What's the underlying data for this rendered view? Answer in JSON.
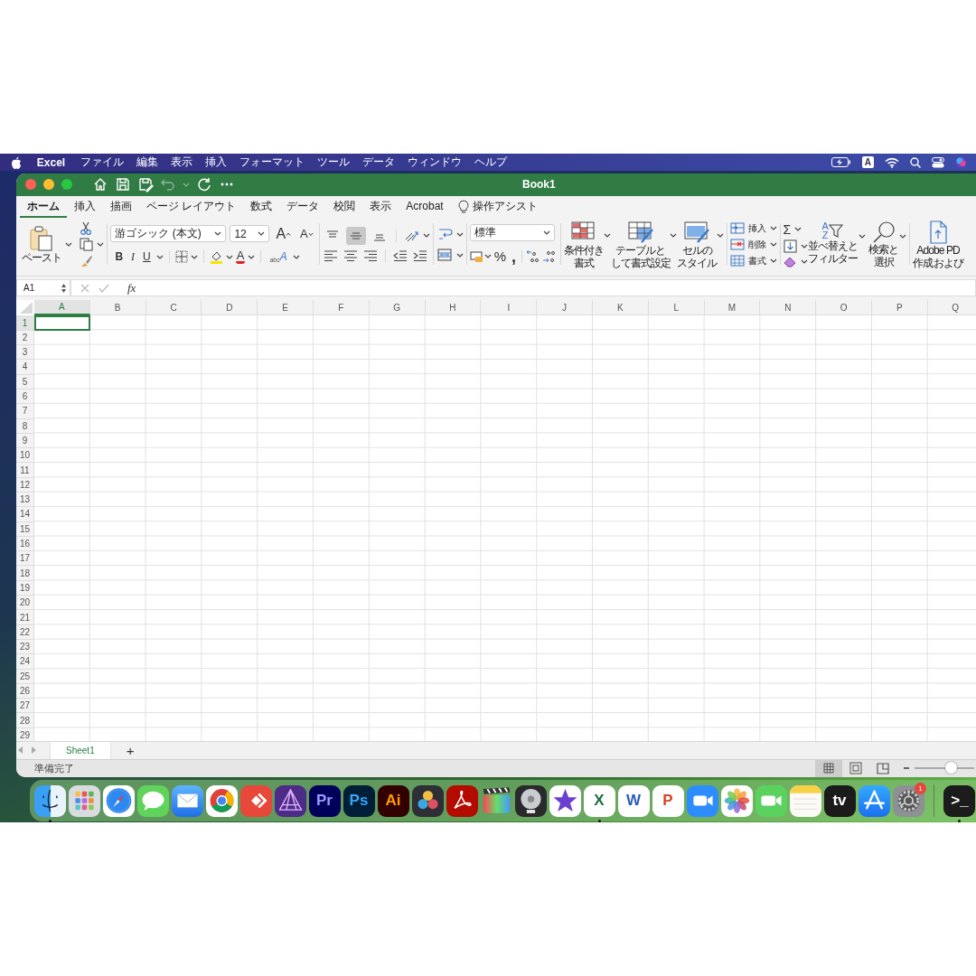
{
  "menu_bar": {
    "app": "Excel",
    "items": [
      "ファイル",
      "編集",
      "表示",
      "挿入",
      "フォーマット",
      "ツール",
      "データ",
      "ウィンドウ",
      "ヘルプ"
    ],
    "input_source": "A"
  },
  "window": {
    "title": "Book1",
    "quick_access": [
      {
        "kind": "home",
        "disabled": false
      },
      {
        "kind": "save",
        "disabled": false
      },
      {
        "kind": "save_as",
        "disabled": false
      },
      {
        "kind": "undo",
        "disabled": true
      },
      {
        "kind": "redo",
        "disabled": false
      },
      {
        "kind": "more",
        "disabled": false
      }
    ]
  },
  "tabs": [
    {
      "label": "ホーム",
      "selected": true
    },
    {
      "label": "挿入",
      "selected": false
    },
    {
      "label": "描画",
      "selected": false
    },
    {
      "label": "ページ レイアウト",
      "selected": false
    },
    {
      "label": "数式",
      "selected": false
    },
    {
      "label": "データ",
      "selected": false
    },
    {
      "label": "校閲",
      "selected": false
    },
    {
      "label": "表示",
      "selected": false
    },
    {
      "label": "Acrobat",
      "selected": false
    }
  ],
  "tell_me": "操作アシスト",
  "ribbon": {
    "paste": "ペースト",
    "font_name": "游ゴシック (本文)",
    "font_size": "12",
    "grow_font": "A",
    "shrink_font": "A",
    "font_styles": [
      {
        "kind": "bold",
        "label": "B"
      },
      {
        "kind": "italic",
        "label": "I"
      },
      {
        "kind": "underline",
        "label": "U"
      }
    ],
    "font_color": "A",
    "phonetic": {
      "small": "abc",
      "big": "A"
    },
    "vertical_align": [
      {
        "kind": "top",
        "selected": false
      },
      {
        "kind": "middle",
        "selected": true
      },
      {
        "kind": "bottom",
        "selected": false
      }
    ],
    "number_format": "標準",
    "percent": "%",
    "comma": ",",
    "styles": [
      {
        "kind": "conditional",
        "lines": [
          "条件付き",
          "書式"
        ]
      },
      {
        "kind": "table",
        "lines": [
          "テーブルと",
          "して書式設定"
        ]
      },
      {
        "kind": "cell",
        "lines": [
          "セルの",
          "スタイル"
        ]
      }
    ],
    "cells": [
      {
        "kind": "insert",
        "label": "挿入"
      },
      {
        "kind": "delete",
        "label": "削除"
      },
      {
        "kind": "format",
        "label": "書式"
      }
    ],
    "sum": "Σ",
    "sort_letters": [
      "A",
      "Z"
    ],
    "sort_filter": [
      "並べ替えと",
      "フィルター"
    ],
    "find_select": [
      "検索と",
      "選択"
    ],
    "adobe": [
      "Adobe PD",
      "作成および"
    ]
  },
  "formula_bar": {
    "name_box": "A1",
    "fx": "fx"
  },
  "grid": {
    "columns": [
      {
        "label": "A",
        "selected": true
      },
      {
        "label": "B",
        "selected": false
      },
      {
        "label": "C",
        "selected": false
      },
      {
        "label": "D",
        "selected": false
      },
      {
        "label": "E",
        "selected": false
      },
      {
        "label": "F",
        "selected": false
      },
      {
        "label": "G",
        "selected": false
      },
      {
        "label": "H",
        "selected": false
      },
      {
        "label": "I",
        "selected": false
      },
      {
        "label": "J",
        "selected": false
      },
      {
        "label": "K",
        "selected": false
      },
      {
        "label": "L",
        "selected": false
      },
      {
        "label": "M",
        "selected": false
      },
      {
        "label": "N",
        "selected": false
      },
      {
        "label": "O",
        "selected": false
      },
      {
        "label": "P",
        "selected": false
      },
      {
        "label": "Q",
        "selected": false
      }
    ],
    "rows": [
      {
        "label": "1",
        "selected": true
      },
      {
        "label": "2",
        "selected": false
      },
      {
        "label": "3",
        "selected": false
      },
      {
        "label": "4",
        "selected": false
      },
      {
        "label": "5",
        "selected": false
      },
      {
        "label": "6",
        "selected": false
      },
      {
        "label": "7",
        "selected": false
      },
      {
        "label": "8",
        "selected": false
      },
      {
        "label": "9",
        "selected": false
      },
      {
        "label": "10",
        "selected": false
      },
      {
        "label": "11",
        "selected": false
      },
      {
        "label": "12",
        "selected": false
      },
      {
        "label": "13",
        "selected": false
      },
      {
        "label": "14",
        "selected": false
      },
      {
        "label": "15",
        "selected": false
      },
      {
        "label": "16",
        "selected": false
      },
      {
        "label": "17",
        "selected": false
      },
      {
        "label": "18",
        "selected": false
      },
      {
        "label": "19",
        "selected": false
      },
      {
        "label": "20",
        "selected": false
      },
      {
        "label": "21",
        "selected": false
      },
      {
        "label": "22",
        "selected": false
      },
      {
        "label": "23",
        "selected": false
      },
      {
        "label": "24",
        "selected": false
      },
      {
        "label": "25",
        "selected": false
      },
      {
        "label": "26",
        "selected": false
      },
      {
        "label": "27",
        "selected": false
      },
      {
        "label": "28",
        "selected": false
      },
      {
        "label": "29",
        "selected": false
      }
    ]
  },
  "sheet_tabs": [
    {
      "label": "Sheet1",
      "selected": true
    }
  ],
  "add_sheet": "+",
  "status_bar": {
    "text": "準備完了",
    "views": [
      {
        "kind": "normal",
        "selected": true
      },
      {
        "kind": "page_layout",
        "selected": false
      },
      {
        "kind": "page_break",
        "selected": false
      }
    ],
    "zoom": {
      "level": 0.6
    }
  },
  "dock": {
    "apps": [
      {
        "kind": "finder",
        "running": true
      },
      {
        "kind": "launchpad",
        "running": false
      },
      {
        "kind": "safari",
        "running": false
      },
      {
        "kind": "messages",
        "running": false
      },
      {
        "kind": "mail",
        "running": false
      },
      {
        "kind": "chrome",
        "running": false
      },
      {
        "kind": "anydesk",
        "running": false
      },
      {
        "kind": "affinity",
        "running": false
      },
      {
        "kind": "premiere",
        "label": "Pr",
        "running": false
      },
      {
        "kind": "photoshop",
        "label": "Ps",
        "running": false
      },
      {
        "kind": "illustrator",
        "label": "Ai",
        "running": false
      },
      {
        "kind": "davinci",
        "running": false
      },
      {
        "kind": "acrobat",
        "running": false
      },
      {
        "kind": "finalcut",
        "running": false
      },
      {
        "kind": "logic",
        "running": false
      },
      {
        "kind": "imovie",
        "running": false
      },
      {
        "kind": "excel",
        "label": "X",
        "running": true
      },
      {
        "kind": "word",
        "label": "W",
        "running": false
      },
      {
        "kind": "powerpoint",
        "label": "P",
        "running": false
      },
      {
        "kind": "zoom",
        "running": false
      },
      {
        "kind": "photos",
        "running": false
      },
      {
        "kind": "facetime",
        "running": false
      },
      {
        "kind": "notes",
        "running": false
      },
      {
        "kind": "tv",
        "label": "tv",
        "running": false
      },
      {
        "kind": "appstore",
        "running": false
      },
      {
        "kind": "settings",
        "badge": "1",
        "running": false
      },
      {
        "kind": "terminal",
        "label": ">_",
        "running": true
      }
    ]
  }
}
